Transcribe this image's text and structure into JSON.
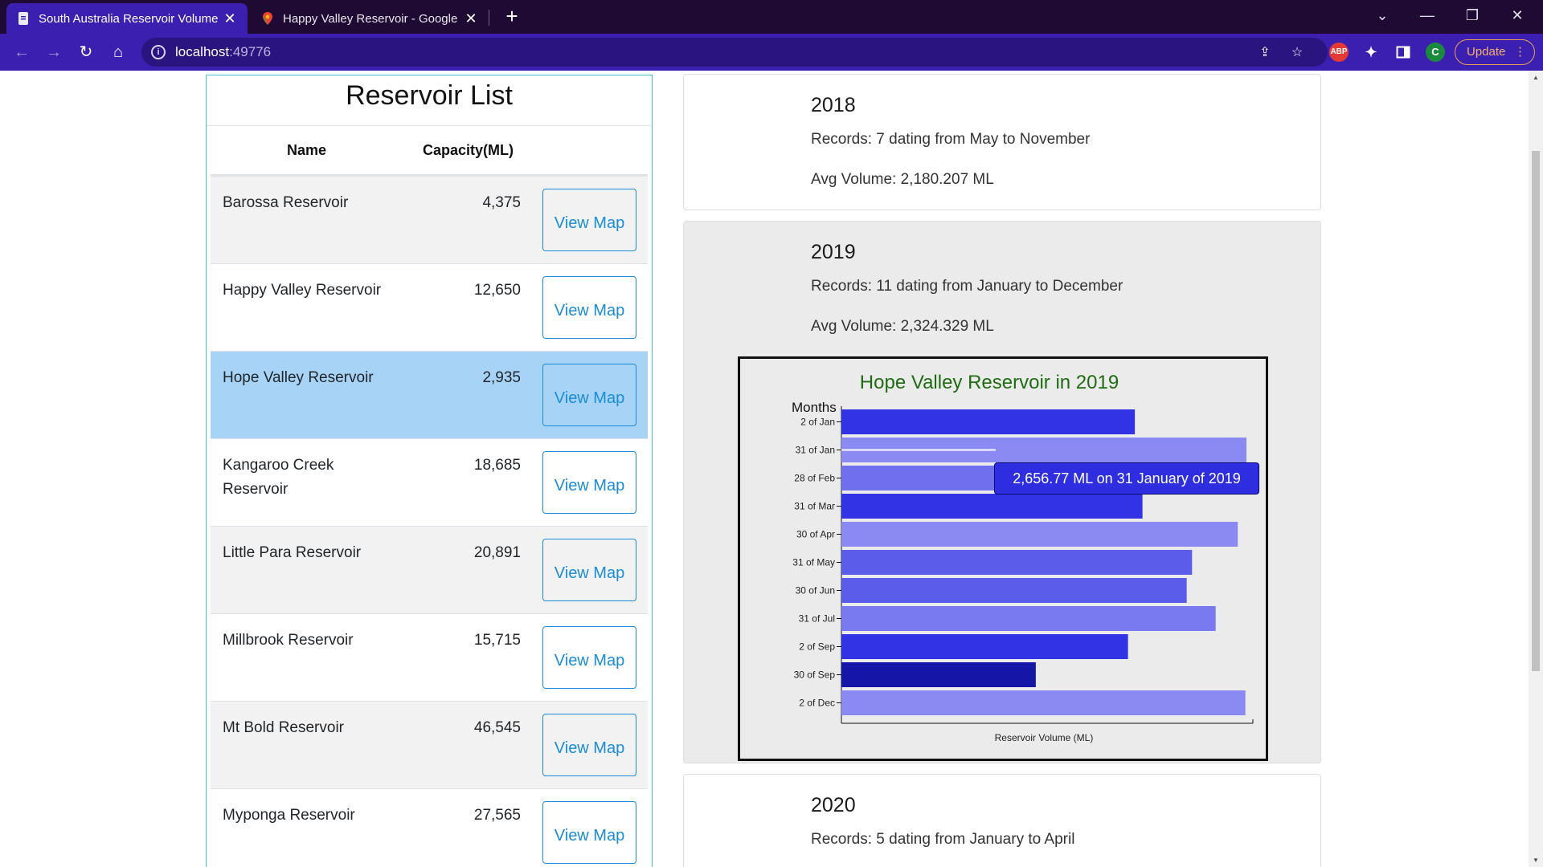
{
  "browser": {
    "tabs": [
      {
        "title": "South Australia Reservoir Volume",
        "active": true
      },
      {
        "title": "Happy Valley Reservoir - Google",
        "active": false
      }
    ],
    "url_host": "localhost",
    "url_port": ":49776",
    "update_label": "Update",
    "profile_initial": "C",
    "abp_label": "ABP"
  },
  "reservoir_list": {
    "title": "Reservoir List",
    "headers": {
      "name": "Name",
      "capacity": "Capacity(ML)"
    },
    "button_label": "View Map",
    "rows": [
      {
        "name": "Barossa Reservoir",
        "capacity": "4,375"
      },
      {
        "name": "Happy Valley Reservoir",
        "capacity": "12,650"
      },
      {
        "name": "Hope Valley Reservoir",
        "capacity": "2,935"
      },
      {
        "name": "Kangaroo Creek Reservoir",
        "capacity": "18,685"
      },
      {
        "name": "Little Para Reservoir",
        "capacity": "20,891"
      },
      {
        "name": "Millbrook Reservoir",
        "capacity": "15,715"
      },
      {
        "name": "Mt Bold Reservoir",
        "capacity": "46,545"
      },
      {
        "name": "Myponga Reservoir",
        "capacity": "27,565"
      }
    ],
    "selected_row": "Hope Valley Reservoir"
  },
  "years": [
    {
      "year": "2018",
      "records": "Records: 7 dating from May to November",
      "avg": "Avg Volume: 2,180.207 ML"
    },
    {
      "year": "2019",
      "records": "Records: 11 dating from January to December",
      "avg": "Avg Volume: 2,324.329 ML"
    },
    {
      "year": "2020",
      "records": "Records: 5 dating from January to April",
      "avg": ""
    }
  ],
  "tooltip": "2,656.77 ML on 31 January of 2019",
  "colors": {
    "bar_dark": "#1515a8",
    "bar_mid": "#3333e6",
    "bar_light": "#8a8af2",
    "title_green": "#1f6b12"
  },
  "chart_data": {
    "type": "bar",
    "orientation": "horizontal",
    "title": "Hope Valley Reservoir in 2019",
    "ylabel": "Months",
    "xlabel": "Reservoir Volume (ML)",
    "categories": [
      "2 of Jan",
      "31 of Jan",
      "28 of Feb",
      "31 of Mar",
      "30 of Apr",
      "31 of May",
      "30 of Jun",
      "31 of Jul",
      "2 of Sep",
      "30 of Sep",
      "2 of Dec"
    ],
    "values": [
      1925,
      2657,
      2400,
      1975,
      2600,
      2300,
      2265,
      2455,
      1880,
      1275,
      2650
    ],
    "bar_colors": [
      "#3333e6",
      "#8a8af2",
      "#7070ee",
      "#3333e6",
      "#8a8af2",
      "#5c5ceb",
      "#5c5ceb",
      "#7a7af0",
      "#3333e6",
      "#1515a8",
      "#8a8af2"
    ],
    "xlim": [
      0,
      2657
    ],
    "grid": false,
    "legend": "none"
  }
}
